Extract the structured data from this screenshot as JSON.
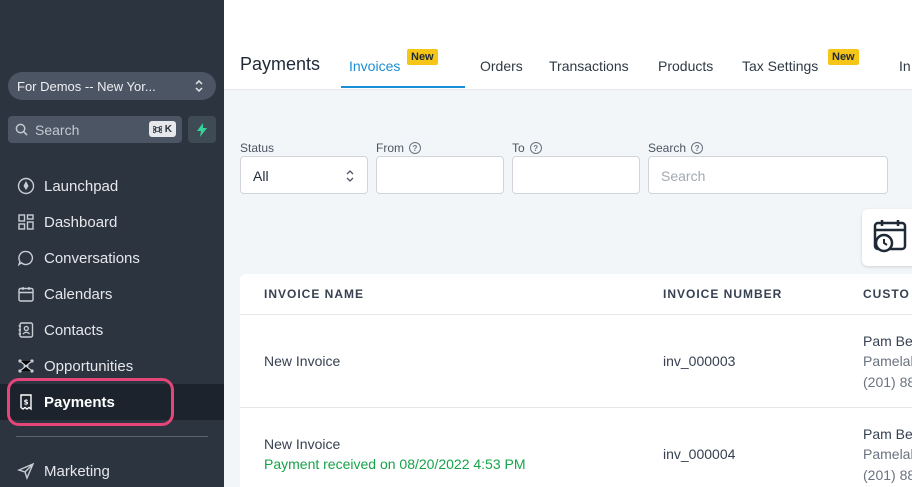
{
  "sidebar": {
    "account": "For Demos -- New Yor...",
    "search_placeholder": "Search",
    "search_shortcut": "K",
    "items": [
      {
        "label": "Launchpad",
        "icon": "rocket-icon"
      },
      {
        "label": "Dashboard",
        "icon": "grid-icon"
      },
      {
        "label": "Conversations",
        "icon": "chat-icon"
      },
      {
        "label": "Calendars",
        "icon": "calendar-icon"
      },
      {
        "label": "Contacts",
        "icon": "contacts-icon"
      },
      {
        "label": "Opportunities",
        "icon": "network-icon"
      },
      {
        "label": "Payments",
        "icon": "receipt-icon"
      },
      {
        "label": "Marketing",
        "icon": "send-icon"
      }
    ]
  },
  "header": {
    "title": "Payments",
    "tabs": [
      {
        "label": "Invoices",
        "badge": "New"
      },
      {
        "label": "Orders"
      },
      {
        "label": "Transactions"
      },
      {
        "label": "Products"
      },
      {
        "label": "Tax Settings",
        "badge": "New"
      },
      {
        "label": "In"
      }
    ]
  },
  "filters": {
    "status_label": "Status",
    "status_value": "All",
    "from_label": "From",
    "to_label": "To",
    "search_label": "Search",
    "search_placeholder": "Search"
  },
  "table": {
    "columns": [
      "INVOICE NAME",
      "INVOICE NUMBER",
      "CUSTO"
    ],
    "rows": [
      {
        "name": "New Invoice",
        "note": "",
        "number": "inv_000003",
        "customer": "Pam Be",
        "customer_email": "Pamelal",
        "customer_phone": "(201) 88"
      },
      {
        "name": "New Invoice",
        "note": "Payment received on 08/20/2022 4:53 PM",
        "number": "inv_000004",
        "customer": "Pam Be",
        "customer_email": "Pamelal",
        "customer_phone": "(201) 88"
      }
    ]
  },
  "colors": {
    "sidebar_bg": "#2c3440",
    "accent": "#1b8fd6",
    "highlight": "#e6457a",
    "badge": "#f5c518",
    "success": "#16a34a"
  }
}
